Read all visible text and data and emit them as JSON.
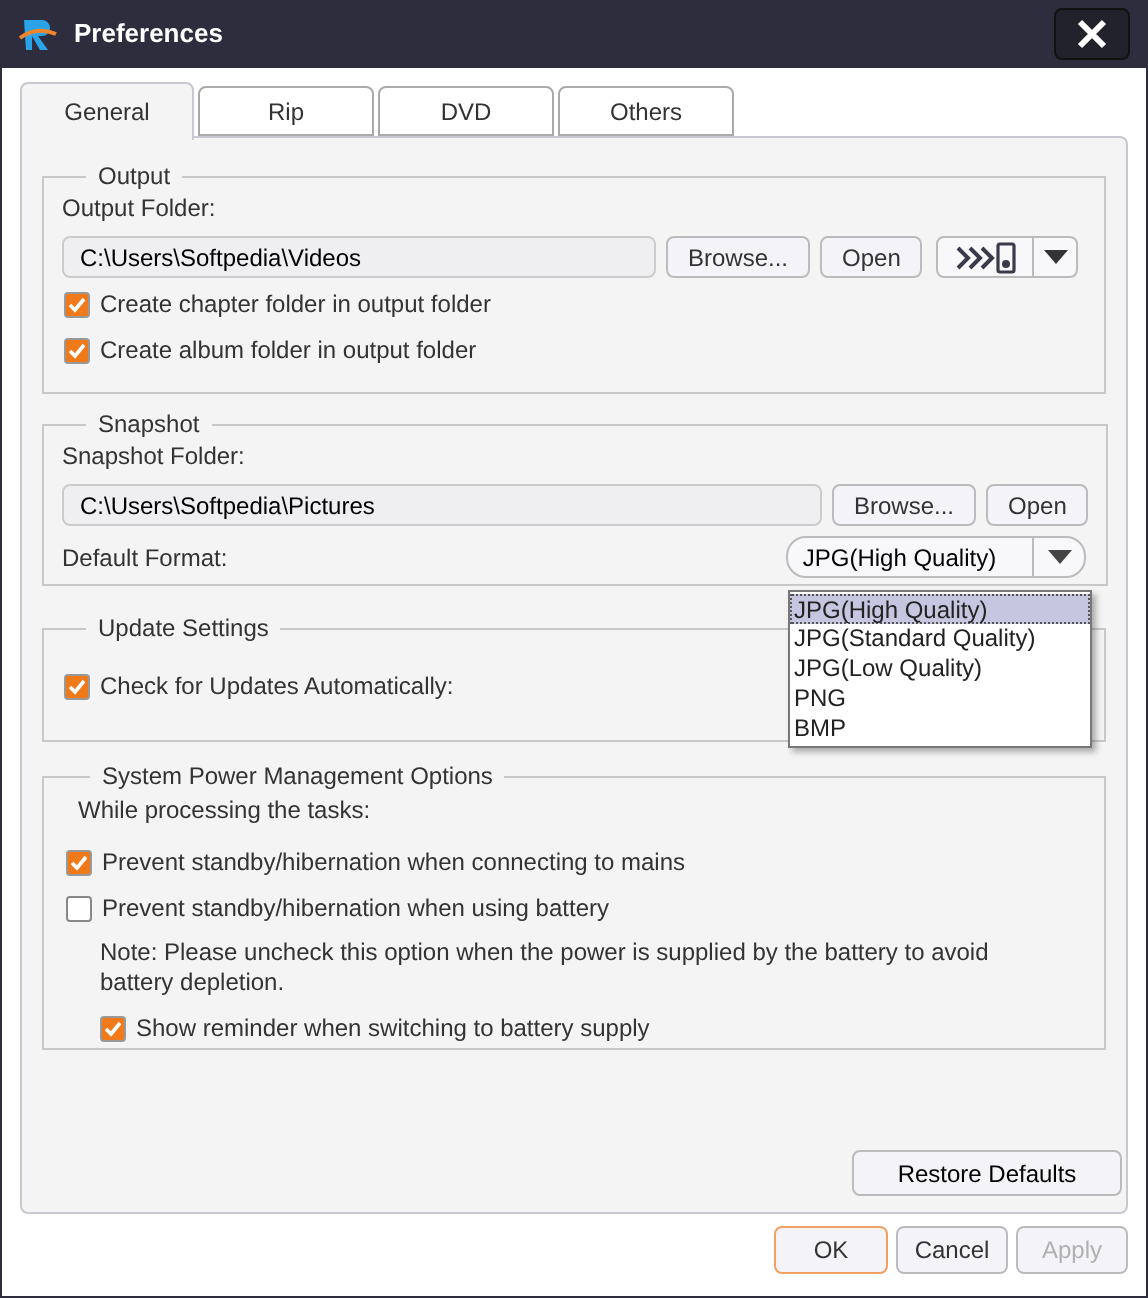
{
  "window": {
    "title": "Preferences"
  },
  "tabs": [
    {
      "label": "General",
      "selected": true
    },
    {
      "label": "Rip",
      "selected": false
    },
    {
      "label": "DVD",
      "selected": false
    },
    {
      "label": "Others",
      "selected": false
    }
  ],
  "output": {
    "legend": "Output",
    "folder_label": "Output Folder:",
    "folder_path": "C:\\Users\\Softpedia\\Videos",
    "buttons": [
      "Browse...",
      "Open"
    ],
    "checkboxes": [
      {
        "label": "Create chapter folder in output folder",
        "checked": true
      },
      {
        "label": "Create album folder in output folder",
        "checked": true
      }
    ]
  },
  "snapshot": {
    "legend": "Snapshot",
    "folder_label": "Snapshot Folder:",
    "folder_path": "C:\\Users\\Softpedia\\Pictures",
    "buttons": [
      "Browse...",
      "Open"
    ],
    "format_label": "Default Format:",
    "format_value": "JPG(High Quality)",
    "options": [
      {
        "label": "JPG(High Quality)",
        "selected": true
      },
      {
        "label": "JPG(Standard Quality)",
        "selected": false
      },
      {
        "label": "JPG(Low Quality)",
        "selected": false
      },
      {
        "label": "PNG",
        "selected": false
      },
      {
        "label": "BMP",
        "selected": false
      }
    ]
  },
  "update": {
    "legend": "Update Settings",
    "checkboxes": [
      {
        "label": "Check for Updates Automatically:",
        "checked": true
      }
    ]
  },
  "power": {
    "legend": "System Power Management Options",
    "intro": "While processing the tasks:",
    "items": [
      {
        "kind": "checkbox",
        "label": "Prevent standby/hibernation when connecting to mains",
        "checked": true
      },
      {
        "kind": "checkbox",
        "label": "Prevent standby/hibernation when using battery",
        "checked": false,
        "children": [
          {
            "kind": "note",
            "label": "Note: Please uncheck this option when the power is supplied by the battery to avoid battery depletion."
          },
          {
            "kind": "checkbox",
            "label": "Show reminder when switching to battery supply",
            "checked": true
          }
        ]
      }
    ]
  },
  "restore_button": "Restore Defaults",
  "footer_buttons": [
    {
      "label": "OK",
      "default": true,
      "disabled": false
    },
    {
      "label": "Cancel",
      "default": false,
      "disabled": false
    },
    {
      "label": "Apply",
      "default": false,
      "disabled": true
    }
  ]
}
